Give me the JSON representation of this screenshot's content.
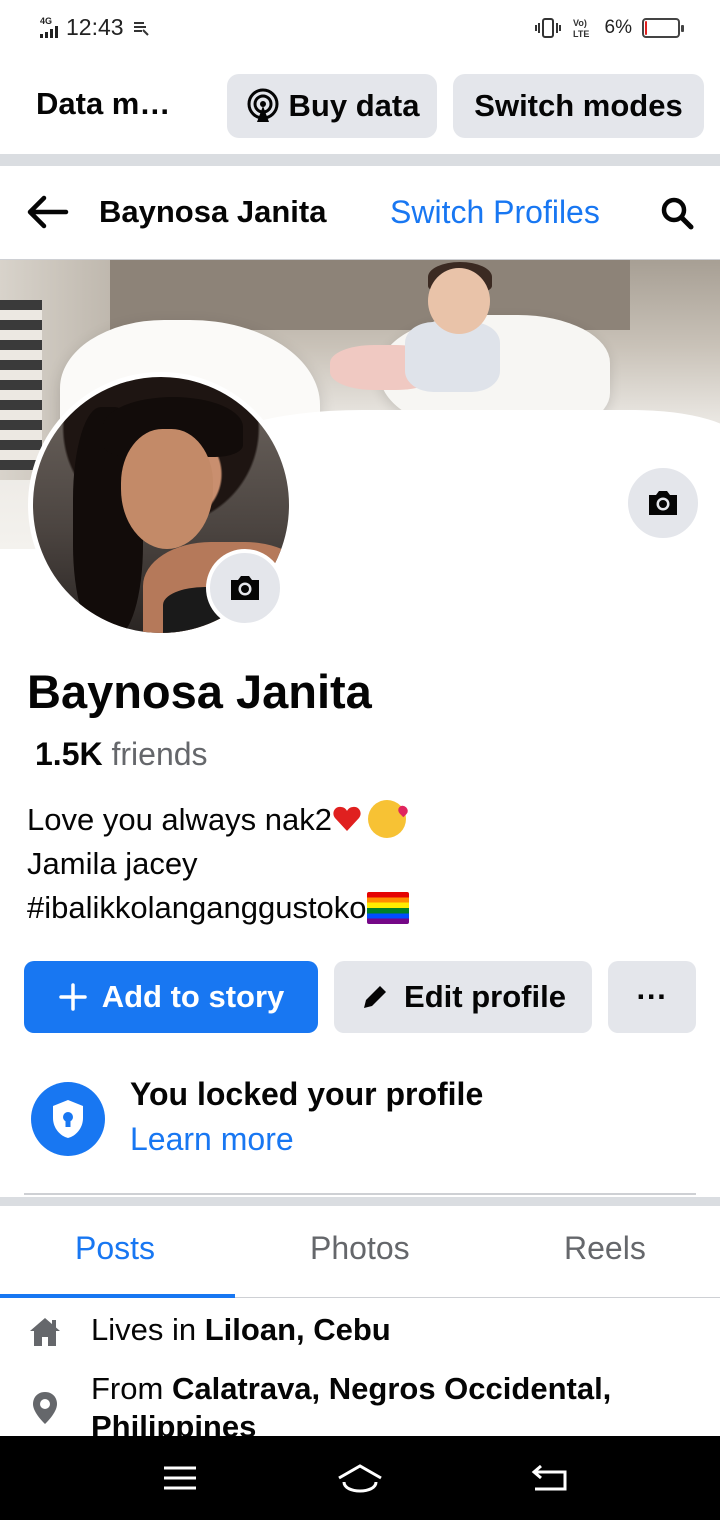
{
  "status_bar": {
    "network": "4G",
    "time": "12:43",
    "volte": "Vo\nLTE",
    "battery_text": "6%",
    "battery_level": 0.06
  },
  "data_banner": {
    "title": "Data mode",
    "buy_data": "Buy data",
    "switch_modes": "Switch modes"
  },
  "header": {
    "title": "Baynosa Janita",
    "switch_profiles": "Switch Profiles"
  },
  "profile": {
    "name": "Baynosa Janita",
    "friends_count": "1.5K",
    "friends_label": "friends",
    "bio_line1": "Love you always nak2",
    "bio_line2": "Jamila jacey",
    "bio_line3": "#ibalikkolanganggustoko"
  },
  "actions": {
    "add_to_story": "Add to story",
    "edit_profile": "Edit profile",
    "more": "···"
  },
  "locked": {
    "title": "You locked your profile",
    "link": "Learn more"
  },
  "tabs": [
    {
      "label": "Posts",
      "active": true
    },
    {
      "label": "Photos",
      "active": false
    },
    {
      "label": "Reels",
      "active": false
    }
  ],
  "intro": {
    "lives_prefix": "Lives in",
    "lives_place": "Liloan, Cebu",
    "from_prefix": "From",
    "from_place": "Calatrava, Negros Occidental, Philippines"
  },
  "colors": {
    "accent": "#1877f2",
    "secondary_bg": "#e4e6eb",
    "muted_text": "#65676b",
    "battery_low": "#e02020"
  }
}
